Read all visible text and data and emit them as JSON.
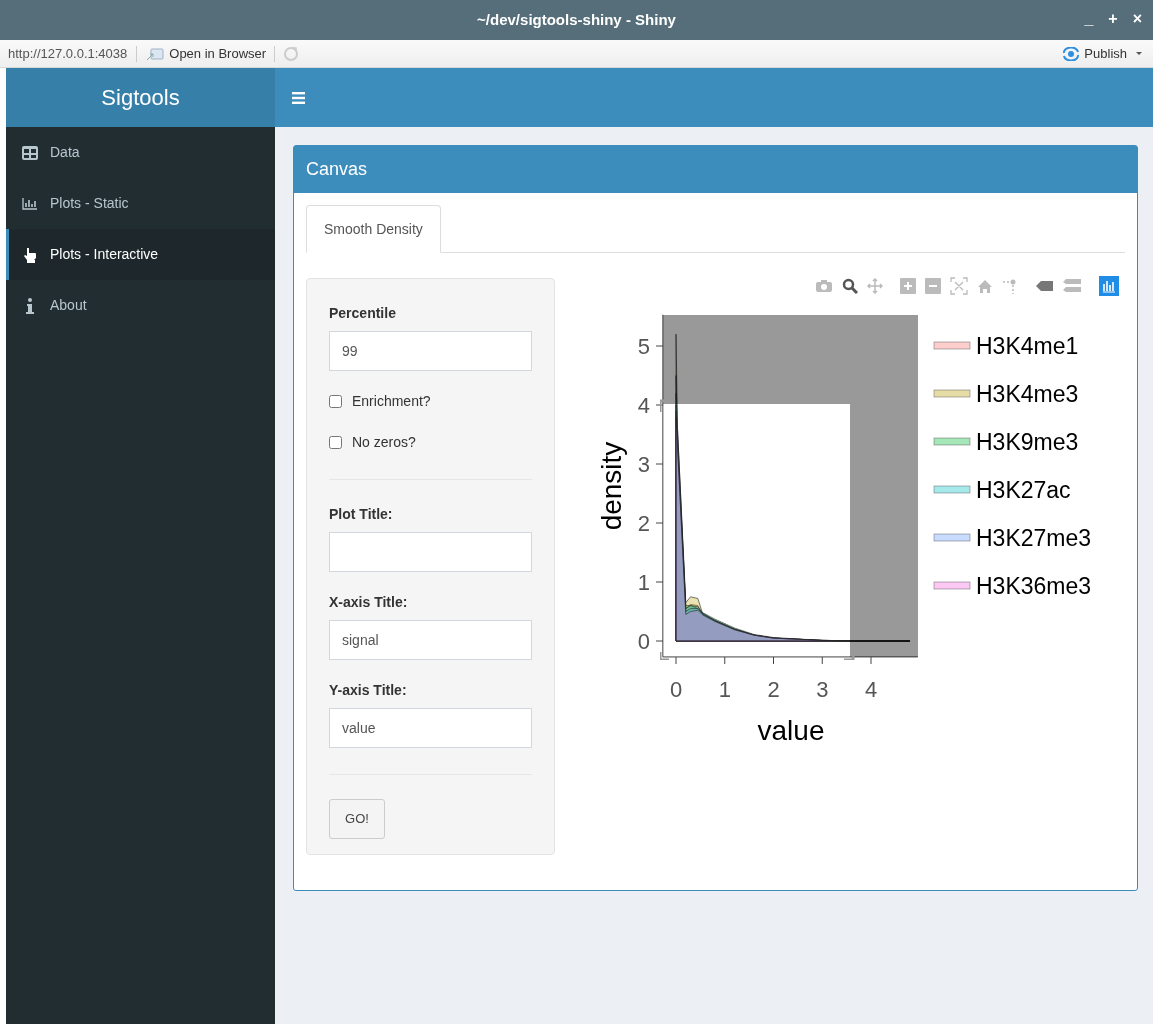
{
  "window": {
    "title": "~/dev/sigtools-shiny - Shiny",
    "controls": [
      "_",
      "+",
      "×"
    ]
  },
  "toolbar": {
    "url": "http://127.0.0.1:4038",
    "open_in_browser": "Open in Browser",
    "publish": "Publish"
  },
  "header": {
    "brand": "Sigtools"
  },
  "sidebar": {
    "items": [
      {
        "label": "Data",
        "selected": false
      },
      {
        "label": "Plots - Static",
        "selected": false
      },
      {
        "label": "Plots - Interactive",
        "selected": true
      },
      {
        "label": "About",
        "selected": false
      }
    ]
  },
  "box": {
    "title": "Canvas",
    "tabs": [
      {
        "label": "Smooth Density",
        "selected": true
      }
    ]
  },
  "form": {
    "fields": [
      {
        "kind": "text",
        "label": "Percentile",
        "value": "99"
      },
      {
        "kind": "checkbox",
        "label": "Enrichment?",
        "checked": false
      },
      {
        "kind": "checkbox",
        "label": "No zeros?",
        "checked": false
      },
      {
        "kind": "divider"
      },
      {
        "kind": "text",
        "label": "Plot Title:"
      },
      {
        "kind": "text",
        "label": "X-axis Title:",
        "value": "signal"
      },
      {
        "kind": "text",
        "label": "Y-axis Title:",
        "value": "value"
      },
      {
        "kind": "divider"
      }
    ],
    "button": "GO!"
  },
  "plot": {
    "chart_data": {
      "type": "area",
      "xlabel": "value",
      "ylabel": "density",
      "x": [
        0,
        0.03,
        0.2,
        0.3,
        0.45,
        0.55,
        0.8,
        1.2,
        1.6,
        2,
        3,
        4,
        4.8
      ],
      "series": [
        {
          "name": "H3K4me1",
          "color": "#f8766d",
          "values": [
            4.2,
            3.5,
            0.55,
            0.62,
            0.6,
            0.45,
            0.34,
            0.2,
            0.1,
            0.05,
            0.01,
            0,
            0
          ]
        },
        {
          "name": "H3K4me3",
          "color": "#b79f00",
          "values": [
            5.2,
            3.6,
            0.65,
            0.75,
            0.72,
            0.45,
            0.35,
            0.2,
            0.1,
            0.05,
            0.01,
            0,
            0
          ]
        },
        {
          "name": "H3K9me3",
          "color": "#00ba38",
          "values": [
            4.0,
            3.4,
            0.6,
            0.6,
            0.55,
            0.48,
            0.37,
            0.22,
            0.11,
            0.06,
            0.01,
            0,
            0
          ]
        },
        {
          "name": "H3K27ac",
          "color": "#00bfc4",
          "values": [
            4.5,
            3.6,
            0.55,
            0.6,
            0.58,
            0.47,
            0.35,
            0.2,
            0.1,
            0.05,
            0.01,
            0,
            0
          ]
        },
        {
          "name": "H3K27me3",
          "color": "#619cff",
          "values": [
            3.8,
            3.3,
            0.5,
            0.55,
            0.55,
            0.46,
            0.34,
            0.2,
            0.1,
            0.05,
            0.01,
            0,
            0
          ]
        },
        {
          "name": "H3K36me3",
          "color": "#f564e3",
          "values": [
            3.9,
            3.3,
            0.45,
            0.5,
            0.52,
            0.44,
            0.33,
            0.19,
            0.1,
            0.05,
            0.01,
            0,
            0
          ]
        }
      ],
      "xticks": [
        0,
        1,
        2,
        3,
        4
      ],
      "yticks": [
        0,
        1,
        2,
        3,
        4,
        5
      ],
      "xlim": [
        -0.27,
        4.96
      ],
      "ylim": [
        -0.27,
        5.53
      ],
      "legend": true
    }
  }
}
